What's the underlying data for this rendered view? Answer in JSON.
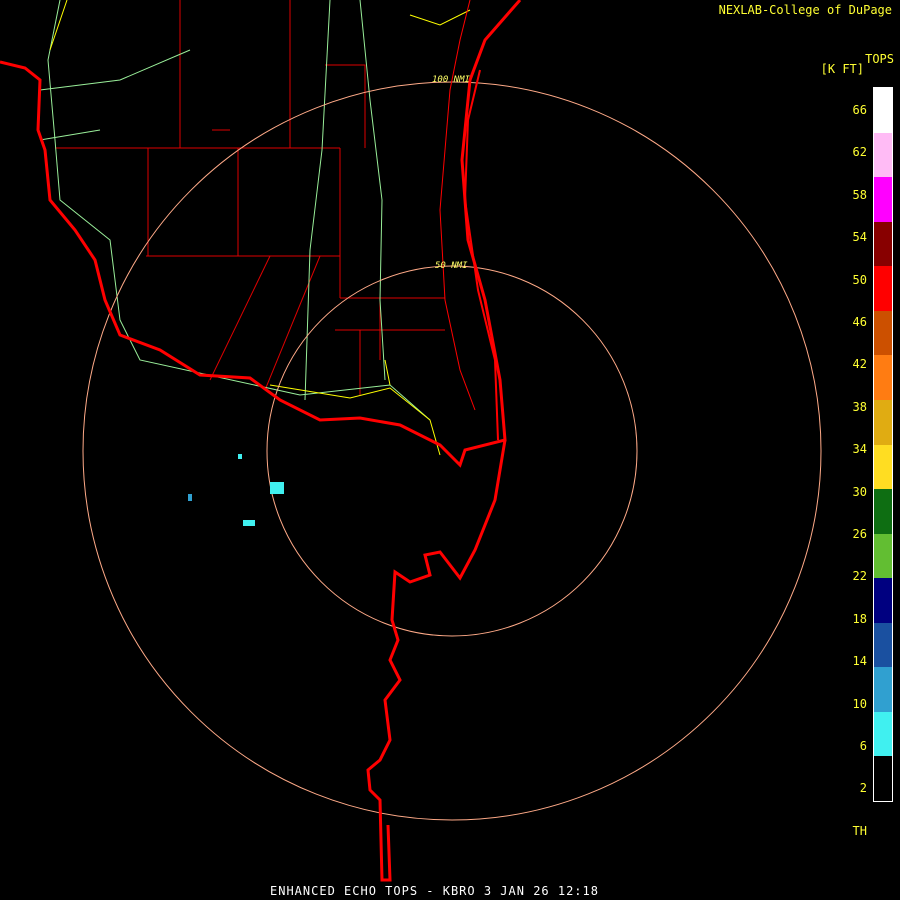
{
  "credit": "NEXLAB-College of DuPage",
  "product_title": "ENHANCED ECHO TOPS - KBRO 3 JAN 26 12:18",
  "legend": {
    "title": "TOPS",
    "units": "[K FT]",
    "labels": [
      "66",
      "62",
      "58",
      "54",
      "50",
      "46",
      "42",
      "38",
      "34",
      "30",
      "26",
      "22",
      "18",
      "14",
      "10",
      "6",
      "2",
      "TH"
    ],
    "colors": [
      "#ffffff",
      "#ffbbf5",
      "#ff00ff",
      "#880000",
      "#ff0000",
      "#cc5000",
      "#ff7c12",
      "#e0ac12",
      "#ffdd22",
      "#0e6e12",
      "#62be32",
      "#000080",
      "#1a50a0",
      "#30a0d0",
      "#40f0f0",
      "#000000"
    ]
  },
  "range_rings": [
    {
      "label": "100 NMI"
    },
    {
      "label": "50 NMI"
    }
  ],
  "colors": {
    "state_border": "#ff0000",
    "county_lines": "#dd0000",
    "highways_major": "#ffff00",
    "highways_minor": "#99ee99",
    "range_rings": "#ffaa88"
  }
}
